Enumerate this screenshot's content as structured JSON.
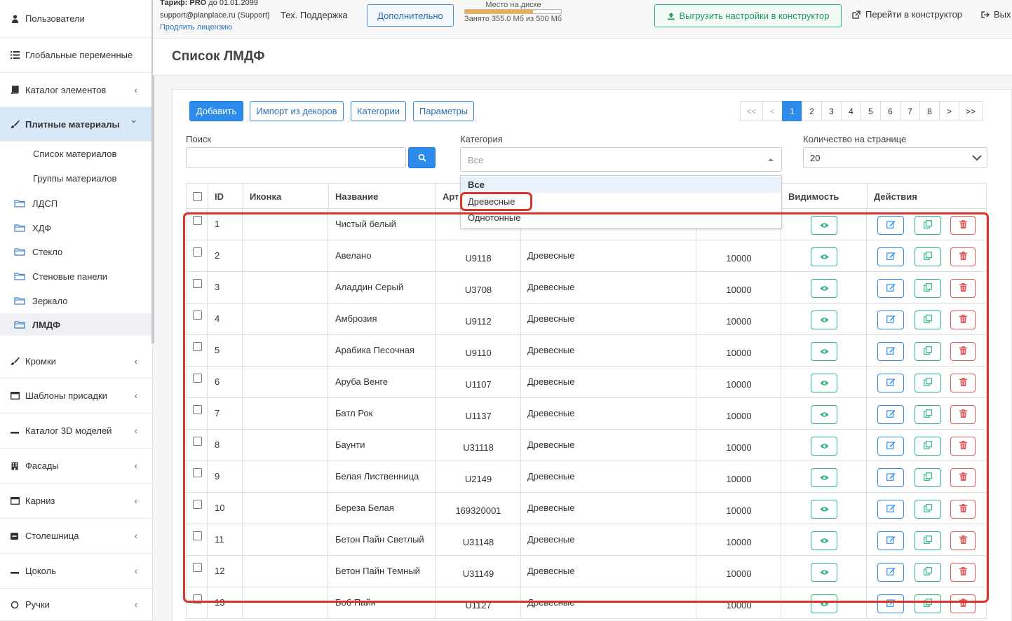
{
  "sidebar": {
    "items": [
      {
        "label": "Пользователи",
        "icon": "user-icon",
        "chevron": false
      },
      {
        "label": "Глобальные переменные",
        "icon": "list-icon",
        "chevron": false
      },
      {
        "label": "Каталог элементов",
        "icon": "book-icon",
        "chevron": true
      },
      {
        "label": "Плитные материалы",
        "icon": "brush-icon",
        "chevron": true,
        "active": true
      },
      {
        "label": "Кромки",
        "icon": "brush-icon",
        "chevron": true
      },
      {
        "label": "Шаблоны присадки",
        "icon": "window-icon",
        "chevron": true
      },
      {
        "label": "Каталог 3D моделей",
        "icon": "minus-icon",
        "chevron": true
      },
      {
        "label": "Фасады",
        "icon": "building-icon",
        "chevron": true
      },
      {
        "label": "Карниз",
        "icon": "window-icon",
        "chevron": true
      },
      {
        "label": "Столешница",
        "icon": "minus-square-icon",
        "chevron": true
      },
      {
        "label": "Цоколь",
        "icon": "minus-icon",
        "chevron": true
      },
      {
        "label": "Ручки",
        "icon": "circle-icon",
        "chevron": true
      }
    ],
    "subitems": [
      "Список материалов",
      "Группы материалов"
    ],
    "folders": [
      "ЛДСП",
      "ХДФ",
      "Стекло",
      "Стеновые панели",
      "Зеркало",
      "ЛМДФ"
    ],
    "active_folder": "ЛМДФ",
    "chevron_left": "‹",
    "chevron_down": "⌄"
  },
  "topbar": {
    "tariff_prefix": "Тариф: PRO",
    "tariff_suffix": " до 01.01.2099",
    "email": "support@planplace.ru (Support)",
    "renew_link": "Продлить лицензию",
    "support_label": "Тех. Поддержка",
    "more_button": "Дополнительно",
    "disk_label": "Место на диске",
    "disk_used": "Занято 355.0 Мб из 500 Мб",
    "disk_fraction": 0.71,
    "upload_button": "Выгрузить настройки в конструктор",
    "constructor_link": "Перейти в конструктор",
    "exit_link": "Вых"
  },
  "page": {
    "title": "Список ЛМДФ"
  },
  "toolbar": {
    "add": "Добавить",
    "import": "Импорт из декоров",
    "categories": "Категории",
    "params": "Параметры"
  },
  "pagination": {
    "first": "<<",
    "prev": "<",
    "pages": [
      "1",
      "2",
      "3",
      "4",
      "5",
      "6",
      "7",
      "8"
    ],
    "current": "1",
    "next": ">",
    "last": ">>"
  },
  "filters": {
    "search_label": "Поиск",
    "search_value": "",
    "category_label": "Категория",
    "category_placeholder": "Все",
    "per_page_label": "Количество на странице",
    "per_page_value": "20"
  },
  "category_dropdown": {
    "options": [
      "Все",
      "Древесные",
      "Однотонные"
    ],
    "highlighted": "Все"
  },
  "table": {
    "headers": {
      "id": "ID",
      "icon": "Иконка",
      "name": "Название",
      "article": "Арт",
      "visibility": "Видимость",
      "actions": "Действия"
    },
    "rows": [
      {
        "id": "1",
        "name": "Чистый белый",
        "article": "",
        "category": "",
        "price": ""
      },
      {
        "id": "2",
        "name": "Авелано",
        "article": "U9118",
        "category": "Древесные",
        "price": "10000"
      },
      {
        "id": "3",
        "name": "Аладдин Серый",
        "article": "U3708",
        "category": "Древесные",
        "price": "10000"
      },
      {
        "id": "4",
        "name": "Амброзия",
        "article": "U9112",
        "category": "Древесные",
        "price": "10000"
      },
      {
        "id": "5",
        "name": "Арабика Песочная",
        "article": "U9110",
        "category": "Древесные",
        "price": "10000"
      },
      {
        "id": "6",
        "name": "Аруба Венге",
        "article": "U1107",
        "category": "Древесные",
        "price": "10000"
      },
      {
        "id": "7",
        "name": "Батл Рок",
        "article": "U1137",
        "category": "Древесные",
        "price": "10000"
      },
      {
        "id": "8",
        "name": "Баунти",
        "article": "U31118",
        "category": "Древесные",
        "price": "10000"
      },
      {
        "id": "9",
        "name": "Белая Лиственница",
        "article": "U2149",
        "category": "Древесные",
        "price": "10000"
      },
      {
        "id": "10",
        "name": "Береза Белая",
        "article": "169320001",
        "category": "Древесные",
        "price": "10000"
      },
      {
        "id": "11",
        "name": "Бетон Пайн Светлый",
        "article": "U31148",
        "category": "Древесные",
        "price": "10000"
      },
      {
        "id": "12",
        "name": "Бетон Пайн Темный",
        "article": "U31149",
        "category": "Древесные",
        "price": "10000"
      },
      {
        "id": "13",
        "name": "Боб Пайн",
        "article": "U1127",
        "category": "Древесные",
        "price": "10000"
      }
    ]
  },
  "colors": {
    "primary": "#2d8ceb",
    "success": "#2eb67d",
    "danger": "#e05a5a",
    "highlight": "#d9362b"
  }
}
